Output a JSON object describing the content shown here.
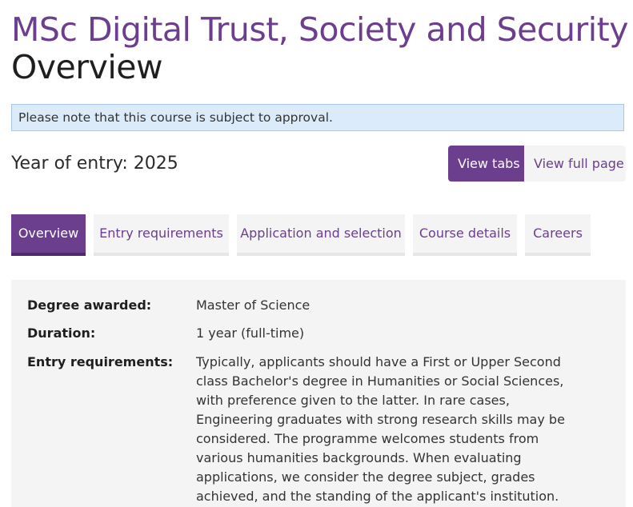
{
  "header": {
    "title": "MSc Digital Trust, Society and Security /",
    "subtitle": "Overview"
  },
  "notice": {
    "text": "Please note that this course is subject to approval."
  },
  "entry": {
    "year_text": "Year of entry: 2025"
  },
  "view_toggle": {
    "tabs_label": "View tabs",
    "full_page_label": "View full page"
  },
  "tabs": [
    {
      "label": "Overview",
      "active": true
    },
    {
      "label": "Entry requirements",
      "active": false
    },
    {
      "label": "Application and selection",
      "active": false
    },
    {
      "label": "Course details",
      "active": false
    },
    {
      "label": "Careers",
      "active": false
    }
  ],
  "details": [
    {
      "label": "Degree awarded:",
      "value": "Master of Science"
    },
    {
      "label": "Duration:",
      "value": "1 year (full-time)"
    },
    {
      "label": "Entry requirements:",
      "value": "Typically, applicants should have a First or Upper Second class Bachelor's degree in Humanities or Social Sciences, with preference given to the latter. In rare cases, Engineering graduates with strong research skills may be considered. The programme welcomes students from various humanities backgrounds. When evaluating applications, we consider the degree subject, grades achieved, and the standing of the applicant's institution."
    }
  ],
  "colors": {
    "brand_purple": "#6b3e8e",
    "notice_bg": "#dcebf9",
    "notice_border": "#a7c8e6",
    "panel_bg": "#f4f4f4"
  }
}
